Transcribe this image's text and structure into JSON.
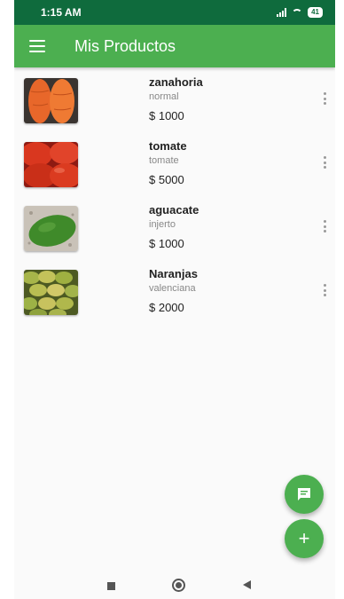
{
  "status_bar": {
    "time": "1:15 AM",
    "battery": "41"
  },
  "app_bar": {
    "title": "Mis Productos"
  },
  "products": [
    {
      "name": "zanahoria",
      "description": "normal",
      "price": "$ 1000",
      "image": "carrot-image"
    },
    {
      "name": "tomate",
      "description": "tomate",
      "price": "$ 5000",
      "image": "tomato-image"
    },
    {
      "name": "aguacate",
      "description": "injerto",
      "price": "$ 1000",
      "image": "avocado-image"
    },
    {
      "name": "Naranjas",
      "description": "valenciana",
      "price": "$ 2000",
      "image": "oranges-image"
    }
  ],
  "fabs": {
    "chat_icon": "chat-icon",
    "add_icon": "plus-icon",
    "add_label": "+"
  },
  "colors": {
    "status_bar": "#0f6b3d",
    "primary": "#4caf50",
    "background": "#fafafa"
  }
}
